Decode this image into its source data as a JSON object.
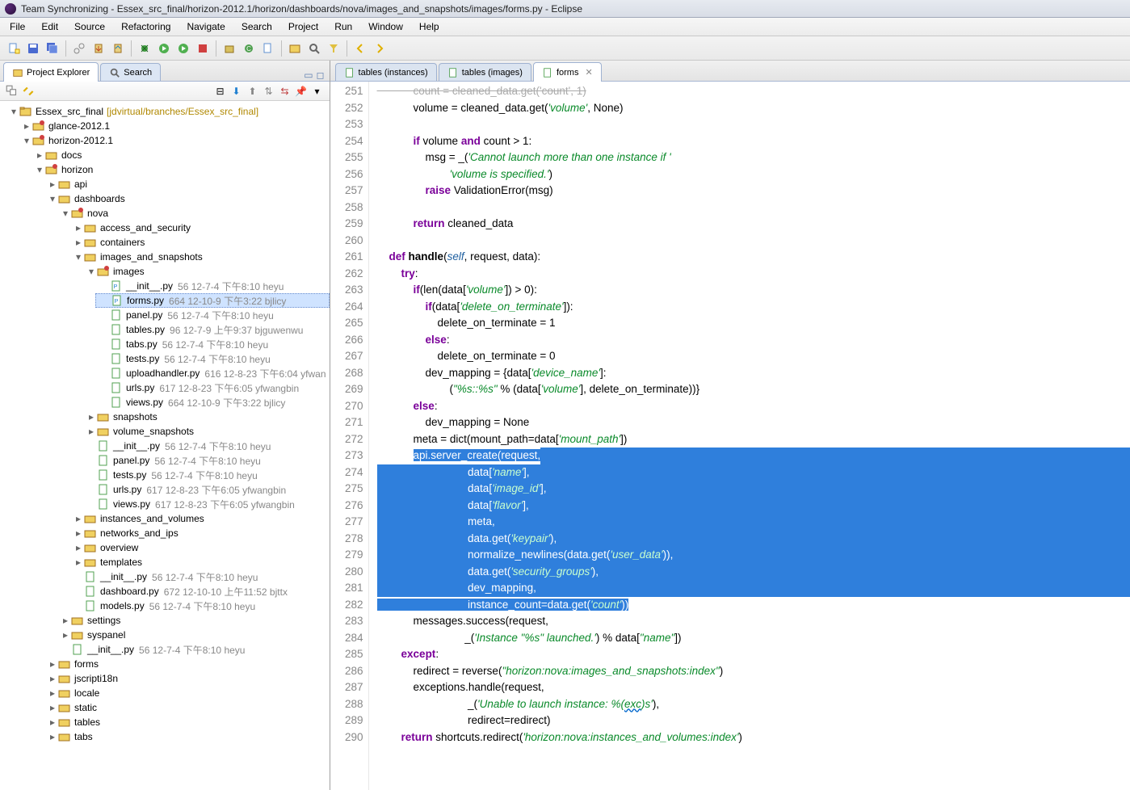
{
  "title": "Team Synchronizing - Essex_src_final/horizon-2012.1/horizon/dashboards/nova/images_and_snapshots/images/forms.py - Eclipse",
  "menu": [
    "File",
    "Edit",
    "Source",
    "Refactoring",
    "Navigate",
    "Search",
    "Project",
    "Run",
    "Window",
    "Help"
  ],
  "left_tabs": {
    "explorer": "Project Explorer",
    "search": "Search"
  },
  "editor_tabs": {
    "tables_inst": "tables (instances)",
    "tables_img": "tables (images)",
    "forms": "forms"
  },
  "project": {
    "root": "Essex_src_final",
    "branch": "[jdvirtual/branches/Essex_src_final]",
    "glance": "glance-2012.1",
    "h": "horizon-2012.1",
    "docs": "docs",
    "horizon": "horizon",
    "api": "api",
    "dashboards": "dashboards",
    "nova": "nova",
    "aas": "access_and_security",
    "containers": "containers",
    "ias": "images_and_snapshots",
    "images": "images",
    "snapshots": "snapshots",
    "vol_snap": "volume_snapshots",
    "iav": "instances_and_volumes",
    "nip": "networks_and_ips",
    "overview": "overview",
    "templates": "templates",
    "settings": "settings",
    "syspanel": "syspanel",
    "forms_f": "forms",
    "jscript": "jscripti18n",
    "locale": "locale",
    "static": "static",
    "tables_f": "tables",
    "tabs_f": "tabs"
  },
  "files": {
    "init_img": {
      "n": "__init__.py",
      "m": "56  12-7-4 下午8:10  heyu"
    },
    "forms": {
      "n": "forms.py",
      "m": "664  12-10-9 下午3:22  bjlicy"
    },
    "panel": {
      "n": "panel.py",
      "m": "56  12-7-4 下午8:10  heyu"
    },
    "tables": {
      "n": "tables.py",
      "m": "96  12-7-9 上午9:37  bjguwenwu"
    },
    "tabs": {
      "n": "tabs.py",
      "m": "56  12-7-4 下午8:10  heyu"
    },
    "tests": {
      "n": "tests.py",
      "m": "56  12-7-4 下午8:10  heyu"
    },
    "upload": {
      "n": "uploadhandler.py",
      "m": "616  12-8-23 下午6:04  yfwan"
    },
    "urls": {
      "n": "urls.py",
      "m": "617  12-8-23 下午6:05  yfwangbin"
    },
    "views": {
      "n": "views.py",
      "m": "664  12-10-9 下午3:22  bjlicy"
    },
    "init_ias": {
      "n": "__init__.py",
      "m": "56  12-7-4 下午8:10  heyu"
    },
    "panel_ias": {
      "n": "panel.py",
      "m": "56  12-7-4 下午8:10  heyu"
    },
    "tests_ias": {
      "n": "tests.py",
      "m": "56  12-7-4 下午8:10  heyu"
    },
    "urls_ias": {
      "n": "urls.py",
      "m": "617  12-8-23 下午6:05  yfwangbin"
    },
    "views_ias": {
      "n": "views.py",
      "m": "617  12-8-23 下午6:05  yfwangbin"
    },
    "init_nova": {
      "n": "__init__.py",
      "m": "56  12-7-4 下午8:10  heyu"
    },
    "dash_nova": {
      "n": "dashboard.py",
      "m": "672  12-10-10 上午11:52  bjttx"
    },
    "models_nova": {
      "n": "models.py",
      "m": "56  12-7-4 下午8:10  heyu"
    },
    "init_dash": {
      "n": "__init__.py",
      "m": "56  12-7-4 下午8:10  heyu"
    }
  },
  "gutter": [
    "251",
    "252",
    "253",
    "254",
    "255",
    "256",
    "257",
    "258",
    "259",
    "260",
    "261",
    "262",
    "263",
    "264",
    "265",
    "266",
    "267",
    "268",
    "269",
    "270",
    "271",
    "272",
    "273",
    "274",
    "275",
    "276",
    "277",
    "278",
    "279",
    "280",
    "281",
    "282",
    "283",
    "284",
    "285",
    "286",
    "287",
    "288",
    "289",
    "290"
  ],
  "code": {
    "l251": "            count = cleaned_data.get('count', 1)",
    "l252a": "            volume = cleaned_data.get(",
    "s252": "'volume'",
    "l252b": ", None)",
    "l254a": "            ",
    "kw254a": "if",
    "l254b": " volume ",
    "kw254b": "and",
    "l254c": " count > 1:",
    "l255a": "                msg = _(",
    "s255": "'Cannot launch more than one instance if '",
    "l256a": "                        ",
    "s256": "'volume is specified.'",
    "l256b": ")",
    "l257a": "                ",
    "kw257": "raise",
    "l257b": " ValidationError(msg)",
    "l259a": "            ",
    "kw259": "return",
    "l259b": " cleaned_data",
    "l261a": "    ",
    "kw261": "def",
    "l261b": " ",
    "fn261": "handle",
    "l261c": "(",
    "sl261": "self",
    "l261d": ", request, data):",
    "l262a": "        ",
    "kw262": "try",
    "l262b": ":",
    "l263a": "            ",
    "kw263": "if",
    "l263b": "(len(data[",
    "s263": "'volume'",
    "l263c": "]) > 0):",
    "l264a": "                ",
    "kw264": "if",
    "l264b": "(data[",
    "s264": "'delete_on_terminate'",
    "l264c": "]):",
    "l265": "                    delete_on_terminate = 1",
    "l266a": "                ",
    "kw266": "else",
    "l266b": ":",
    "l267": "                    delete_on_terminate = 0",
    "l268a": "                dev_mapping = {data[",
    "s268": "'device_name'",
    "l268b": "]:",
    "l269a": "                        (",
    "s269a": "\"%s::%s\"",
    "l269b": " % (data[",
    "s269b": "'volume'",
    "l269c": "], delete_on_terminate))}",
    "l270a": "            ",
    "kw270": "else",
    "l270b": ":",
    "l271": "                dev_mapping = None",
    "l272a": "            meta = dict(mount_path=data[",
    "s272": "'mount_path'",
    "l272b": "])",
    "l273a": "            ",
    "sel273": "api.server_create(request,",
    "sel274": "                              data[",
    "ss274": "'name'",
    "sel274b": "],",
    "sel275": "                              data[",
    "ss275": "'image_id'",
    "sel275b": "],",
    "sel276": "                              data[",
    "ss276": "'flavor'",
    "sel276b": "],",
    "sel277": "                              meta,",
    "sel278": "                              data.get(",
    "ss278": "'keypair'",
    "sel278b": "),",
    "sel279": "                              normalize_newlines(data.get(",
    "ss279": "'user_data'",
    "sel279b": ")),",
    "sel280": "                              data.get(",
    "ss280": "'security_groups'",
    "sel280b": "),",
    "sel281": "                              dev_mapping,",
    "sel282": "                              instance_count=data.get(",
    "ss282": "'count'",
    "sel282b": "))",
    "l283": "            messages.success(request,",
    "l284a": "                             _(",
    "s284": "'Instance \"%s\" launched.'",
    "l284b": ") % data[",
    "s284b": "\"name\"",
    "l284c": "])",
    "l285a": "        ",
    "kw285": "except",
    "l285b": ":",
    "l286a": "            redirect = reverse(",
    "s286": "\"horizon:nova:images_and_snapshots:index\"",
    "l286b": ")",
    "l287": "            exceptions.handle(request,",
    "l288a": "                              _(",
    "s288a": "'Unable to launch instance: %(",
    "sq288": "exc",
    "s288b": ")s'",
    "l288b": "),",
    "l289": "                              redirect=redirect)",
    "l290a": "        ",
    "kw290": "return",
    "l290b": " shortcuts.redirect(",
    "s290": "'horizon:nova:instances_and_volumes:index'",
    "l290c": ")"
  }
}
